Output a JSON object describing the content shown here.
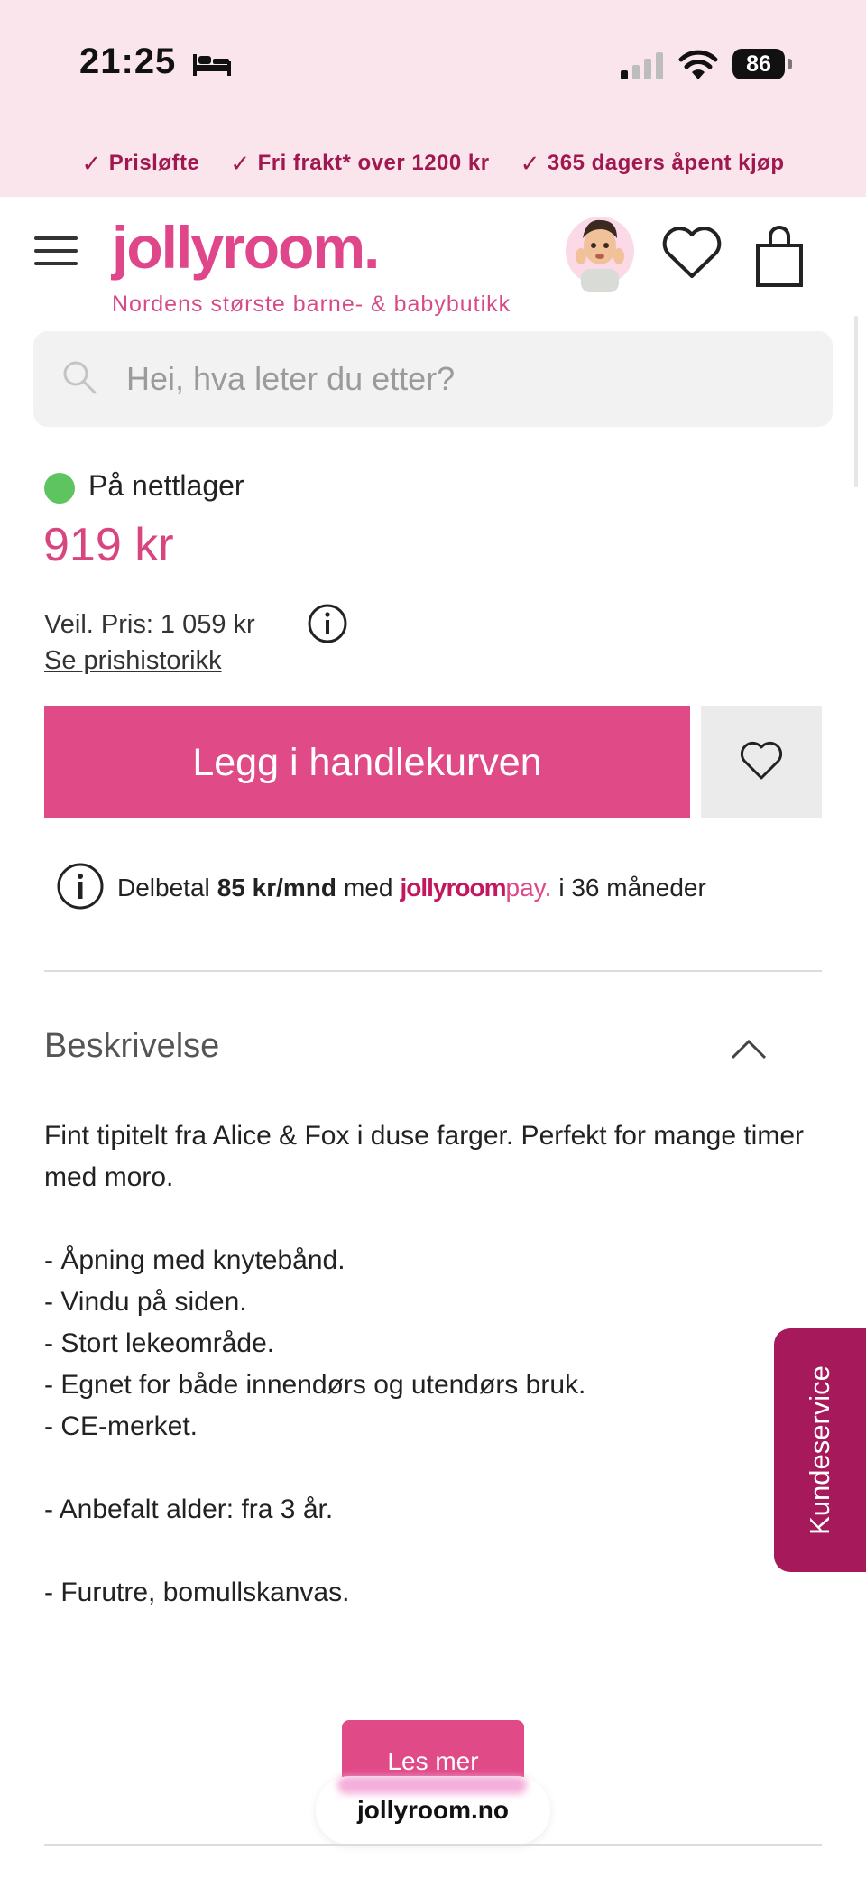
{
  "status_bar": {
    "time": "21:25",
    "battery": "86"
  },
  "promo": [
    {
      "check": "✓",
      "label": "Prisløfte"
    },
    {
      "check": "✓",
      "label": "Fri frakt* over 1200 kr"
    },
    {
      "check": "✓",
      "label": "365 dagers åpent kjøp"
    }
  ],
  "header": {
    "logo": "jollyroom.",
    "tagline": "Nordens største barne- & babybutikk"
  },
  "search": {
    "placeholder": "Hei, hva leter du etter?"
  },
  "product": {
    "stock": "På nettlager",
    "price": "919 kr",
    "recommended_price": "Veil. Pris: 1 059 kr",
    "price_history_link": "Se prishistorikk",
    "add_to_cart": "Legg i handlekurven"
  },
  "installment": {
    "prefix": "Delbetal",
    "amount": "85 kr/mnd",
    "with": "med",
    "brand": "jollyroom",
    "brand_suffix": "pay.",
    "suffix": "i 36 måneder"
  },
  "description": {
    "heading": "Beskrivelse",
    "intro": "Fint tipitelt fra Alice & Fox i duse farger. Perfekt for mange timer med moro.",
    "bullets": [
      "- Åpning med knytebånd.",
      "- Vindu på siden.",
      "- Stort lekeområde.",
      "- Egnet for både innendørs og utendørs bruk.",
      "- CE-merket."
    ],
    "age": "- Anbefalt alder: fra 3 år.",
    "material": "- Furutre, bomullskanvas.",
    "read_more": "Les mer"
  },
  "side_tab": {
    "label": "Kundeservice"
  },
  "browser": {
    "url": "jollyroom.no"
  },
  "colors": {
    "brand_pink": "#e04a87",
    "dark_pink": "#a6195a",
    "promo_bg": "#fbe5ec",
    "stock_green": "#5ec460"
  }
}
